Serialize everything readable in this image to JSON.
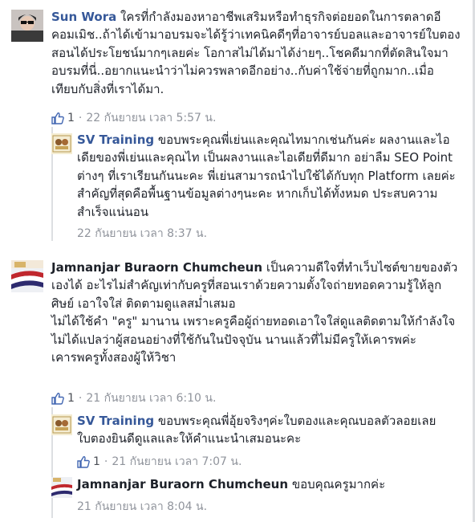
{
  "comments": [
    {
      "name": "Sun Wora",
      "text": "ใครที่กำลังมองหาอาชีพเสริมหรือทำธุรกิจต่อยอดในการตลาดอีคอมเมิช..ถ้าได้เข้ามาอบรมจะได้รู้ว่าเทคนิคดีๆที่อาจารย์บอลและอาจารย์ใบตองสอนได้ประโยชน์มากๆเลยค่ะ โอกาสไม่ได้มาได้ง่ายๆ..โชคดีมากที่ตัดสินใจมาอบรมที่นี่..อยากแนะนำว่าไม่ควรพลาดอีกอย่าง..กับค่าใช้จ่ายที่ถูกมาก..เมื่อเทียบกับสิ่งที่เราได้มา.",
      "like_count": "1",
      "timestamp": "22 กันยายน เวลา 5:57 น.",
      "reply": {
        "name": "SV Training",
        "text": "ขอบพระคุณพี่เย่นและคุณไทมากเช่นกันค่ะ ผลงานและไอเดียของพี่เย่นและคุณไท เป็นผลงานและไอเดียที่ดีมาก อย่าลืม SEO Point ต่างๆ ที่เราเรียนกันนะคะ พี่เย่นสามารถนำไปใช้ได้กับทุก Platform เลยค่ะ สำคัญที่สุดคือพื้นฐานข้อมูลต่างๆนะคะ หากเก็บได้ทั้งหมด ประสบความสำเร็จแน่นอน",
        "timestamp": "22 กันยายน เวลา 8:37 น."
      }
    },
    {
      "name": "Jamnanjar Buraorn Chumcheun",
      "text_line1": "เป็นความดีใจที่ทำเว็บไซต์ขายของตัวเองได้ อะไรไม่สำคัญเท่ากับครูที่สอนเราด้วยความตั้งใจถ่ายทอดความรู้ให้ลูกศิษย์ เอาใจใส่ ติดตามดูแลสม่ำเสมอ",
      "text_line2": "ไม่ได้ใช้คำ \"ครู\" มานาน เพราะครูคือผู้ถ่ายทอดเอาใจใส่ดูแลติดตามให้กำลังใจ ไม่ได้แปลว่าผู้สอนอย่างที่ใช้กันในปัจจุบัน นานแล้วที่ไม่มีครูให้เคารพค่ะ",
      "text_line3": "เคารพครูทั้งสองผู้ให้วิชา",
      "like_count": "1",
      "timestamp": "21 กันยายน เวลา 6:10 น.",
      "reply1": {
        "name": "SV Training",
        "text": "ขอบพระคุณพี่อุ้ยจริงๆค่ะใบตองและคุณบอลตัวลอยเลย ใบตองยินดีดูแลและให้คำแนะนำเสมอนะคะ",
        "like_count": "1",
        "timestamp": "21 กันยายน เวลา 7:07 น."
      },
      "reply2": {
        "name": "Jamnanjar Buraorn Chumcheun",
        "text": "ขอบคุณครูมากค่ะ",
        "timestamp": "21 กันยายน เวลา 8:04 น."
      }
    }
  ],
  "separator": "·",
  "colors": {
    "name_link": "#365899",
    "meta": "#90949c",
    "like_blue": "#4267b2"
  }
}
